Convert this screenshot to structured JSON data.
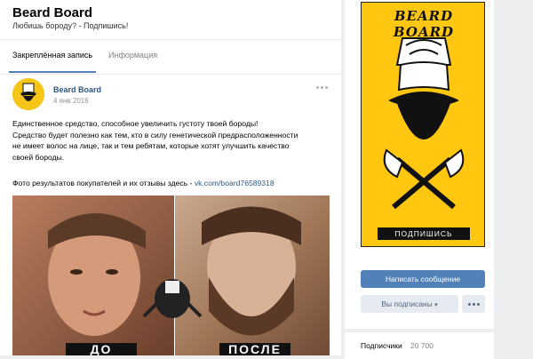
{
  "group": {
    "title": "Beard Board",
    "status": "Любишь бороду? - Подпишись!"
  },
  "tabs": [
    {
      "label": "Закреплённая запись"
    },
    {
      "label": "Информация"
    }
  ],
  "post": {
    "author": "Beard Board",
    "date": "4 янв 2016",
    "text_lines": [
      "Единственное средство, способное увеличить густоту твоей бороды!",
      "Средство будет полезно как тем, кто в силу генетической предрасположенности",
      "не имеет волос на лице, так и тем ребятам, которые хотят улучшить качество",
      "своей бороды."
    ],
    "photo_caption": "Фото результатов покупателей и их отзывы здесь - ",
    "link": "vk.com/board76589318"
  },
  "sidebar": {
    "brand": "BEARD BOARD",
    "subscribe_banner": "ПОДПИШИСЬ",
    "message_button": "Написать сообщение",
    "subscribed_button": "Вы подписаны",
    "subscribers_label": "Подписчики",
    "subscribers_count": "20 700"
  },
  "colors": {
    "accent": "#5181b8",
    "link": "#2a5885",
    "brand_yellow": "#ffc70f"
  }
}
